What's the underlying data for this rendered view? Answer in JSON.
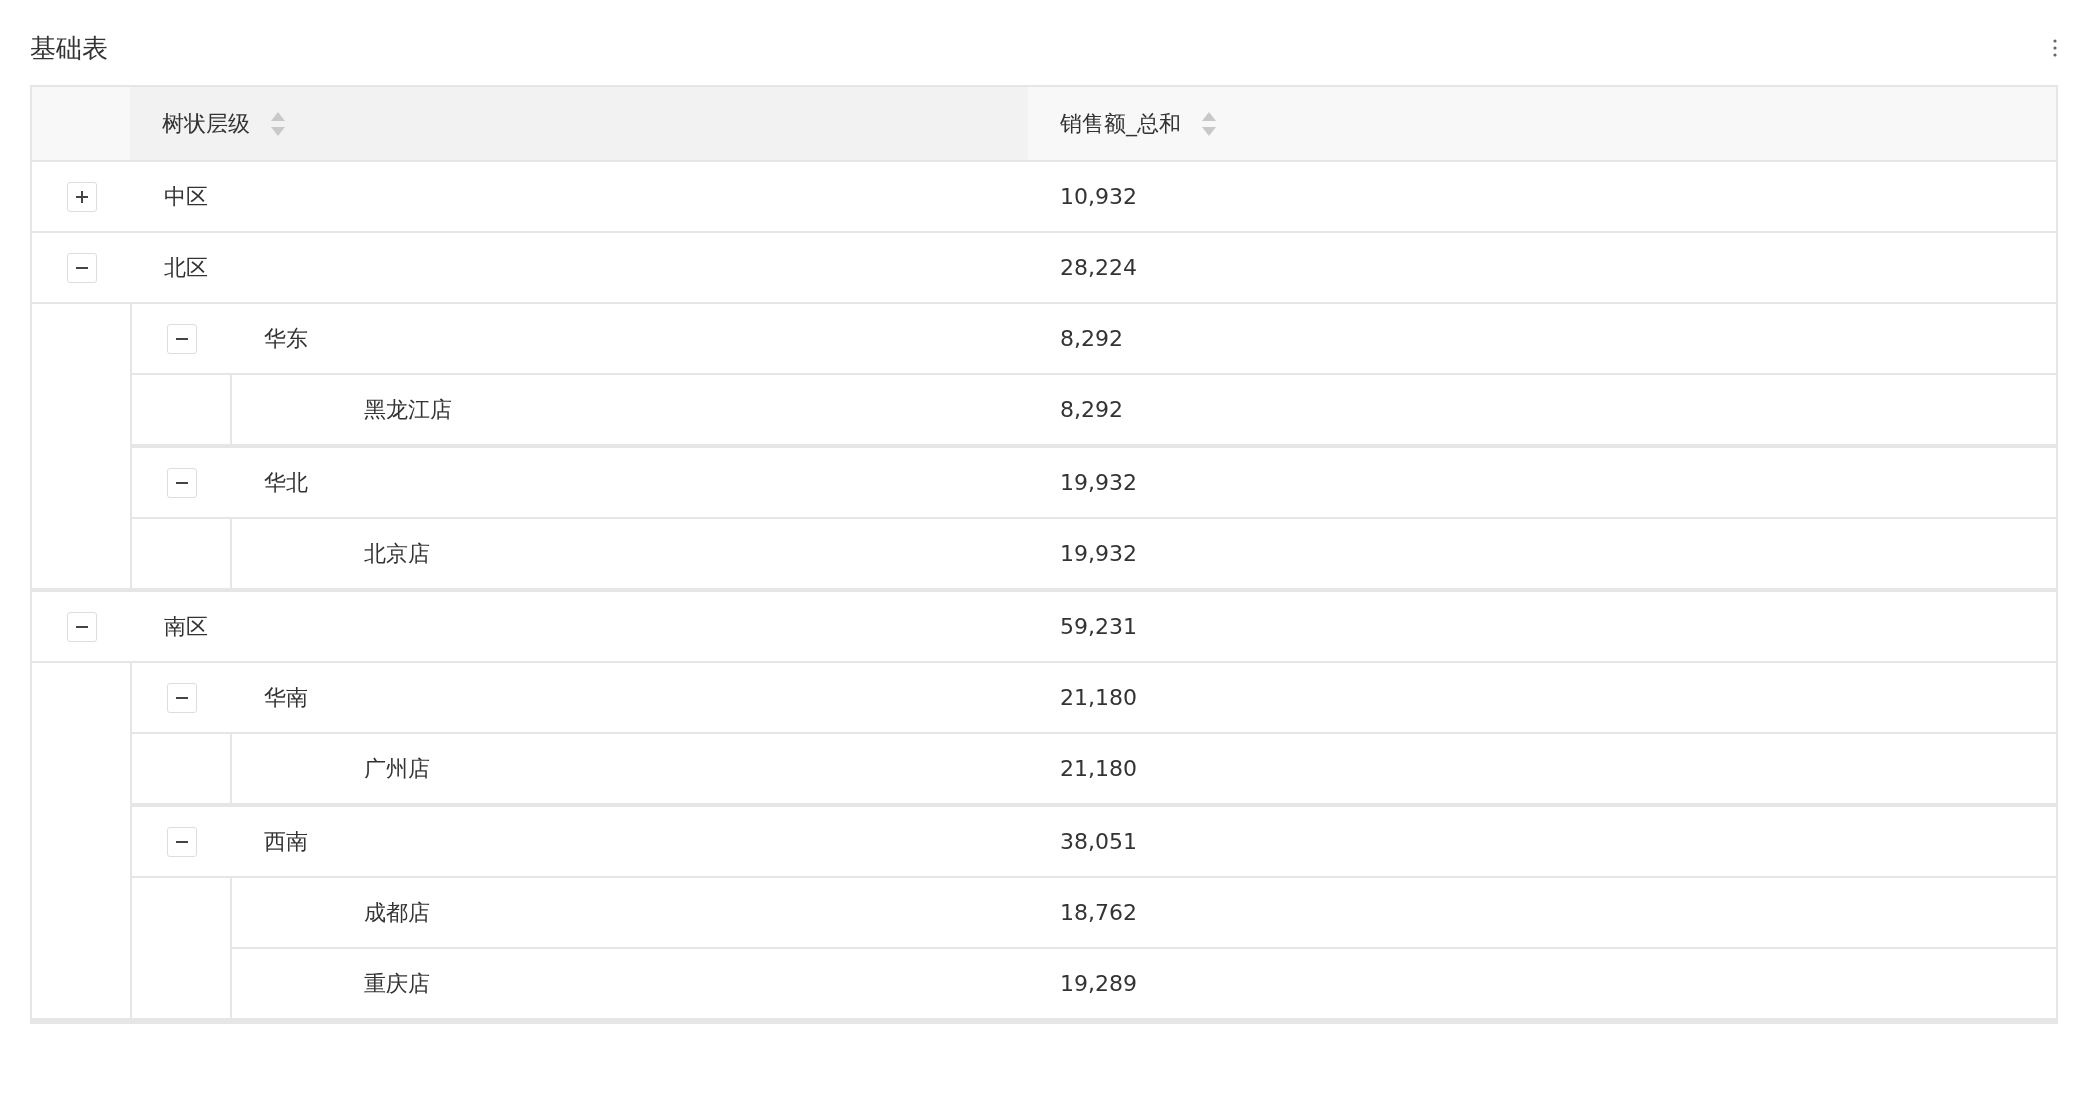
{
  "title": "基础表",
  "columns": [
    {
      "label": "树状层级"
    },
    {
      "label": "销售额_总和"
    }
  ],
  "rows": [
    {
      "name": "中区",
      "value": "10,932",
      "expanded": false
    },
    {
      "name": "北区",
      "value": "28,224",
      "expanded": true,
      "children": [
        {
          "name": "华东",
          "value": "8,292",
          "expanded": true,
          "children": [
            {
              "name": "黑龙江店",
              "value": "8,292"
            }
          ]
        },
        {
          "name": "华北",
          "value": "19,932",
          "expanded": true,
          "children": [
            {
              "name": "北京店",
              "value": "19,932"
            }
          ]
        }
      ]
    },
    {
      "name": "南区",
      "value": "59,231",
      "expanded": true,
      "children": [
        {
          "name": "华南",
          "value": "21,180",
          "expanded": true,
          "children": [
            {
              "name": "广州店",
              "value": "21,180"
            }
          ]
        },
        {
          "name": "西南",
          "value": "38,051",
          "expanded": true,
          "children": [
            {
              "name": "成都店",
              "value": "18,762"
            },
            {
              "name": "重庆店",
              "value": "19,289"
            }
          ]
        }
      ]
    }
  ]
}
